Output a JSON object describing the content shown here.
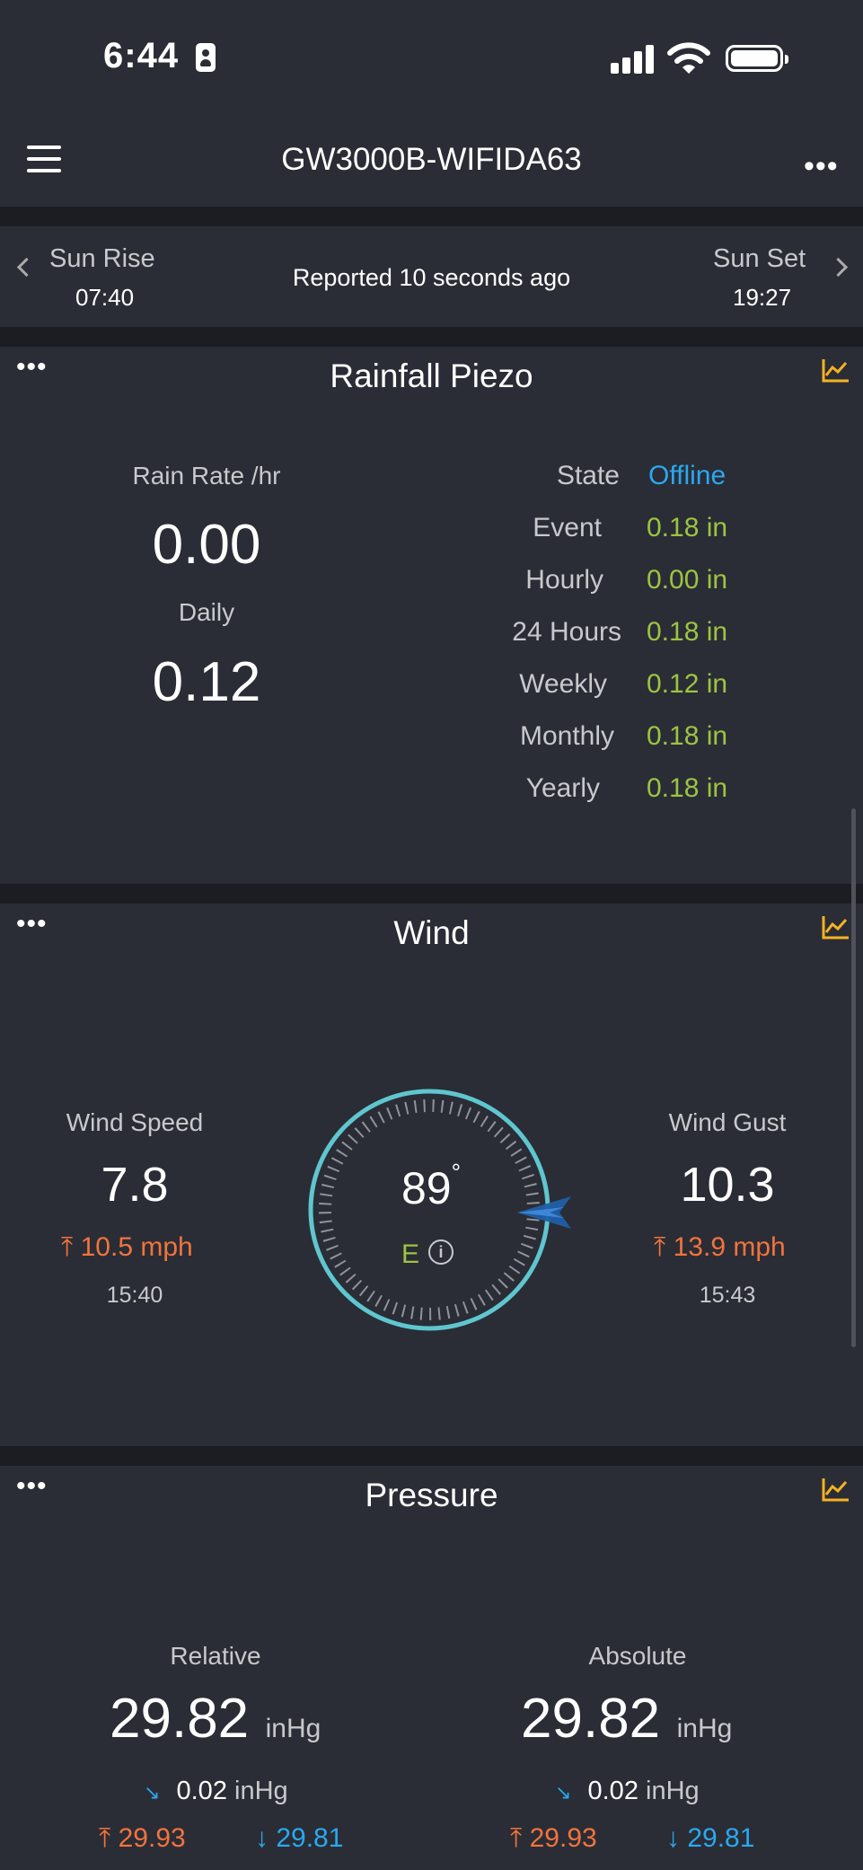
{
  "status_bar": {
    "time": "6:44"
  },
  "header": {
    "title": "GW3000B-WIFIDA63"
  },
  "sun": {
    "rise_label": "Sun Rise",
    "rise_time": "07:40",
    "reported": "Reported 10 seconds ago",
    "set_label": "Sun Set",
    "set_time": "19:27"
  },
  "rainfall": {
    "title": "Rainfall Piezo",
    "rate_label": "Rain Rate /hr",
    "rate_value": "0.00",
    "daily_label": "Daily",
    "daily_value": "0.12",
    "rows": [
      {
        "key": "State",
        "value": "Offline"
      },
      {
        "key": "Event",
        "value": "0.18 in"
      },
      {
        "key": "Hourly",
        "value": "0.00 in"
      },
      {
        "key": "24 Hours",
        "value": "0.18 in"
      },
      {
        "key": "Weekly",
        "value": "0.12 in"
      },
      {
        "key": "Monthly",
        "value": "0.18 in"
      },
      {
        "key": "Yearly",
        "value": "0.18 in"
      }
    ]
  },
  "wind": {
    "title": "Wind",
    "speed_label": "Wind Speed",
    "speed_value": "7.8",
    "speed_max": "10.5 mph",
    "speed_time": "15:40",
    "direction_degrees": "89",
    "degree_symbol": "°",
    "direction_cardinal": "E",
    "gust_label": "Wind Gust",
    "gust_value": "10.3",
    "gust_max": "13.9 mph",
    "gust_time": "15:43"
  },
  "pressure": {
    "title": "Pressure",
    "relative_label": "Relative",
    "relative_value": "29.82",
    "relative_unit": "inHg",
    "relative_trend": "0.02",
    "relative_trend_unit": "inHg",
    "relative_high": "29.93",
    "relative_low": "29.81",
    "absolute_label": "Absolute",
    "absolute_value": "29.82",
    "absolute_unit": "inHg",
    "absolute_trend": "0.02",
    "absolute_trend_unit": "inHg",
    "absolute_high": "29.93",
    "absolute_low": "29.81"
  },
  "colors": {
    "background": "#1b1d22",
    "card": "#2a2d35",
    "green": "#9ec342",
    "blue": "#2aa8f0",
    "orange": "#f2733d",
    "chart_icon": "#f5b321",
    "compass_ring": "#5fc6cf"
  },
  "icons": {
    "menu": "hamburger-icon",
    "more": "more-icon",
    "chart": "chart-icon",
    "prev": "chevron-left-icon",
    "next": "chevron-right-icon",
    "info": "info-icon",
    "max": "arrow-up-icon",
    "min": "arrow-down-icon",
    "trend": "trend-down-icon"
  }
}
